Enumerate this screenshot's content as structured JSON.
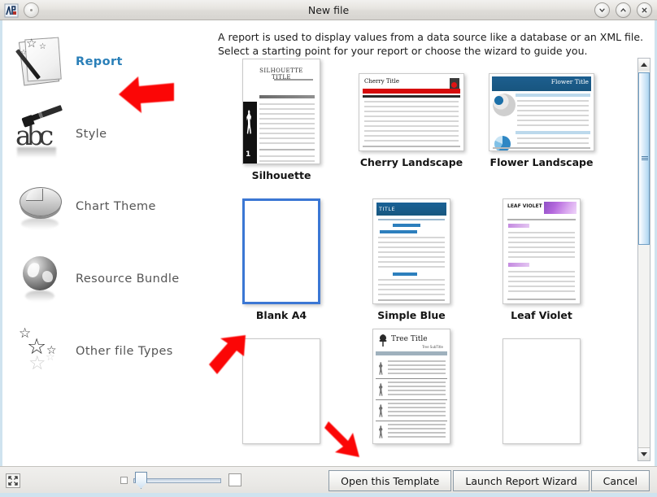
{
  "window": {
    "title": "New file",
    "app_icon": "app-icon",
    "menu_dot": "window-menu-dot",
    "controls": [
      {
        "name": "minimize-button",
        "glyph": "chevron-down"
      },
      {
        "name": "maximize-button",
        "glyph": "chevron-up"
      },
      {
        "name": "close-button",
        "glyph": "close-x"
      }
    ]
  },
  "sidebar": {
    "items": [
      {
        "label": "Report",
        "icon": "report-wizard-icon",
        "active": true
      },
      {
        "label": "Style",
        "icon": "style-brush-icon",
        "active": false
      },
      {
        "label": "Chart Theme",
        "icon": "pie-chart-icon",
        "active": false
      },
      {
        "label": "Resource Bundle",
        "icon": "globe-icon",
        "active": false
      },
      {
        "label": "Other file Types",
        "icon": "stars-icon",
        "active": false
      }
    ]
  },
  "content": {
    "description_line1": "A report is used to display values from a data source like a database or an XML file.",
    "description_line2": "Select a starting point for your report or choose the wizard to guide you.",
    "templates": [
      {
        "label": "Silhouette",
        "style": "silhouette",
        "selected": false,
        "partial": false
      },
      {
        "label": "Cherry Landscape",
        "style": "cherry",
        "selected": false,
        "partial": false
      },
      {
        "label": "Flower Landscape",
        "style": "flower",
        "selected": false,
        "partial": false
      },
      {
        "label": "Blank A4",
        "style": "blank",
        "selected": true,
        "partial": false
      },
      {
        "label": "Simple Blue",
        "style": "simpleblue",
        "selected": false,
        "partial": false
      },
      {
        "label": "Leaf Violet",
        "style": "leafviolet",
        "selected": false,
        "partial": false
      },
      {
        "label": "",
        "style": "blank",
        "selected": false,
        "partial": true
      },
      {
        "label": "",
        "style": "tree",
        "selected": false,
        "partial": true
      },
      {
        "label": "",
        "style": "blank",
        "selected": false,
        "partial": true
      }
    ],
    "thumbnail_text": {
      "silhouette_title": "SILHOUETTE TITLE",
      "silhouette_page_number": "1",
      "cherry_title": "Cherry Title",
      "flower_title": "Flower Title",
      "simple_blue_title": "TITLE",
      "leaf_violet_title": "LEAF VIOLET TITLE",
      "tree_title": "Tree Title"
    }
  },
  "scrollbar": {
    "name": "vertical-scrollbar",
    "up_arrow": "scroll-up-arrow",
    "down_arrow": "scroll-down-arrow",
    "thumb_position_percent": 2,
    "thumb_size_percent": 45
  },
  "footer": {
    "fit_icon": "fit-to-window-icon",
    "zoom_small_icon": "small-thumbnails-icon",
    "zoom_large_icon": "large-thumbnails-icon",
    "slider_name": "thumbnail-size-slider",
    "slider_value_percent": 4,
    "buttons": [
      {
        "label": "Open this Template",
        "name": "open-this-template-button"
      },
      {
        "label": "Launch Report Wizard",
        "name": "launch-report-wizard-button"
      },
      {
        "label": "Cancel",
        "name": "cancel-button"
      }
    ]
  },
  "annotations": {
    "arrows": [
      {
        "name": "annotation-arrow-report",
        "direction": "up-left"
      },
      {
        "name": "annotation-arrow-blank-a4",
        "direction": "up-right"
      },
      {
        "name": "annotation-arrow-row3",
        "direction": "down-right"
      }
    ],
    "color": "#fb0606"
  }
}
